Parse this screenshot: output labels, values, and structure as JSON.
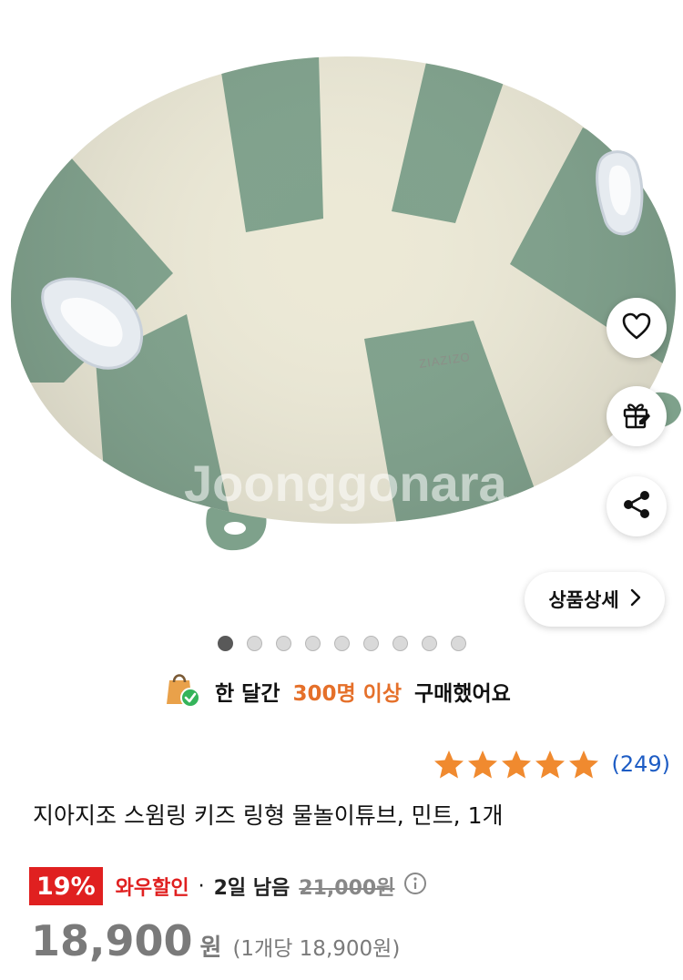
{
  "hero": {
    "brand_imprint": "ZIAZIZO",
    "watermark": "Joonggonara",
    "colors": {
      "stripe_green": "#7ea18b",
      "stripe_cream": "#ece9d6"
    }
  },
  "actions": {
    "like_icon": "heart-icon",
    "gift_icon": "gift-icon",
    "share_icon": "share-icon",
    "detail_label": "상품상세"
  },
  "gallery": {
    "image_count": 9,
    "active_index": 0
  },
  "purchase": {
    "prefix": "한 달간",
    "highlight": "300명 이상",
    "suffix": "구매했어요",
    "highlight_color": "#e5702a"
  },
  "rating": {
    "stars": 5,
    "review_count": "(249)",
    "star_color": "#f08a2f"
  },
  "product": {
    "title": "지아지조 스윔링 키즈 링형 물놀이튜브, 민트, 1개"
  },
  "deal": {
    "discount": "19%",
    "wow_label": "와우할인",
    "separator": "·",
    "remaining": "2일 남음",
    "original_price": "21,000원"
  },
  "price": {
    "amount": "18,900",
    "unit": "원",
    "per_unit": "(1개당 18,900원)"
  }
}
